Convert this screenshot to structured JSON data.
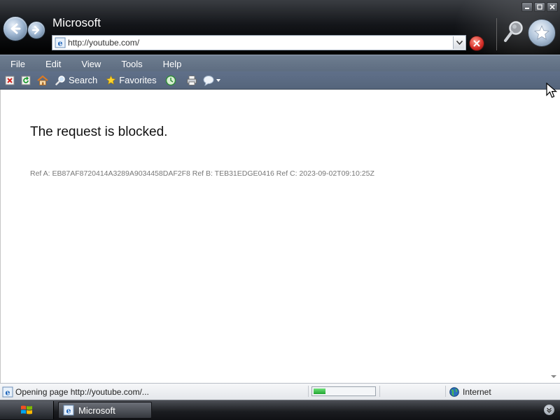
{
  "browser": {
    "title": "Microsoft",
    "address": "http://youtube.com/"
  },
  "menu": {
    "items": [
      "File",
      "Edit",
      "View",
      "Tools",
      "Help"
    ]
  },
  "toolbar": {
    "search_label": "Search",
    "favorites_label": "Favorites"
  },
  "page": {
    "heading": "The request is blocked.",
    "ref_line": "Ref A: EB87AF8720414A3289A9034458DAF2F8 Ref B: TEB31EDGE0416 Ref C: 2023-09-02T09:10:25Z"
  },
  "status": {
    "text": "Opening page http://youtube.com/...",
    "progress": 0.2,
    "zone": "Internet"
  },
  "taskbar": {
    "task_label": "Microsoft"
  },
  "colors": {
    "menubar": "#66768a",
    "progress": "#2fb83f",
    "stop": "#d0201a"
  }
}
